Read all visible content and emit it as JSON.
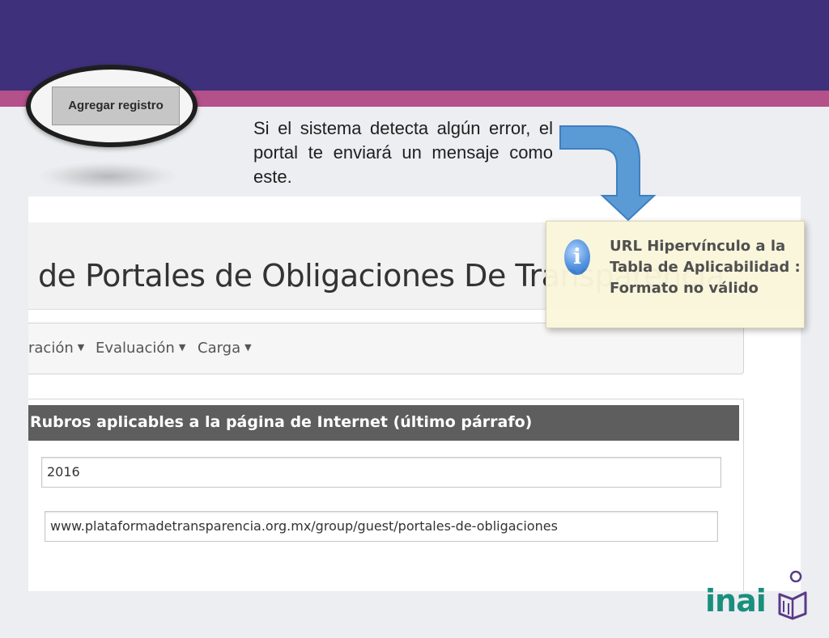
{
  "slide": {
    "add_button_label": "Agregar registro",
    "caption": "Si el sistema detecta algún error, el portal te enviará un mensaje como este."
  },
  "portal": {
    "title": "de Portales de Obligaciones De Transparencia",
    "nav": [
      {
        "label": "ración"
      },
      {
        "label": "Evaluación"
      },
      {
        "label": "Carga"
      }
    ],
    "panel_title": "Rubros aplicables a la página de Internet (último párrafo)",
    "year_value": "2016",
    "url_value": "www.plataformadetransparencia.org.mx/group/guest/portales-de-obligaciones"
  },
  "toast": {
    "icon": "info-icon",
    "message": "URL Hipervínculo a la Tabla de Aplicabilidad : Formato no válido"
  },
  "logo": {
    "text": "inai"
  },
  "colors": {
    "header_purple": "#3f307b",
    "header_pink": "#b4508a",
    "arrow_blue": "#5b9bd5",
    "logo_teal": "#1a8f7e",
    "book_purple": "#5a3a8a"
  }
}
